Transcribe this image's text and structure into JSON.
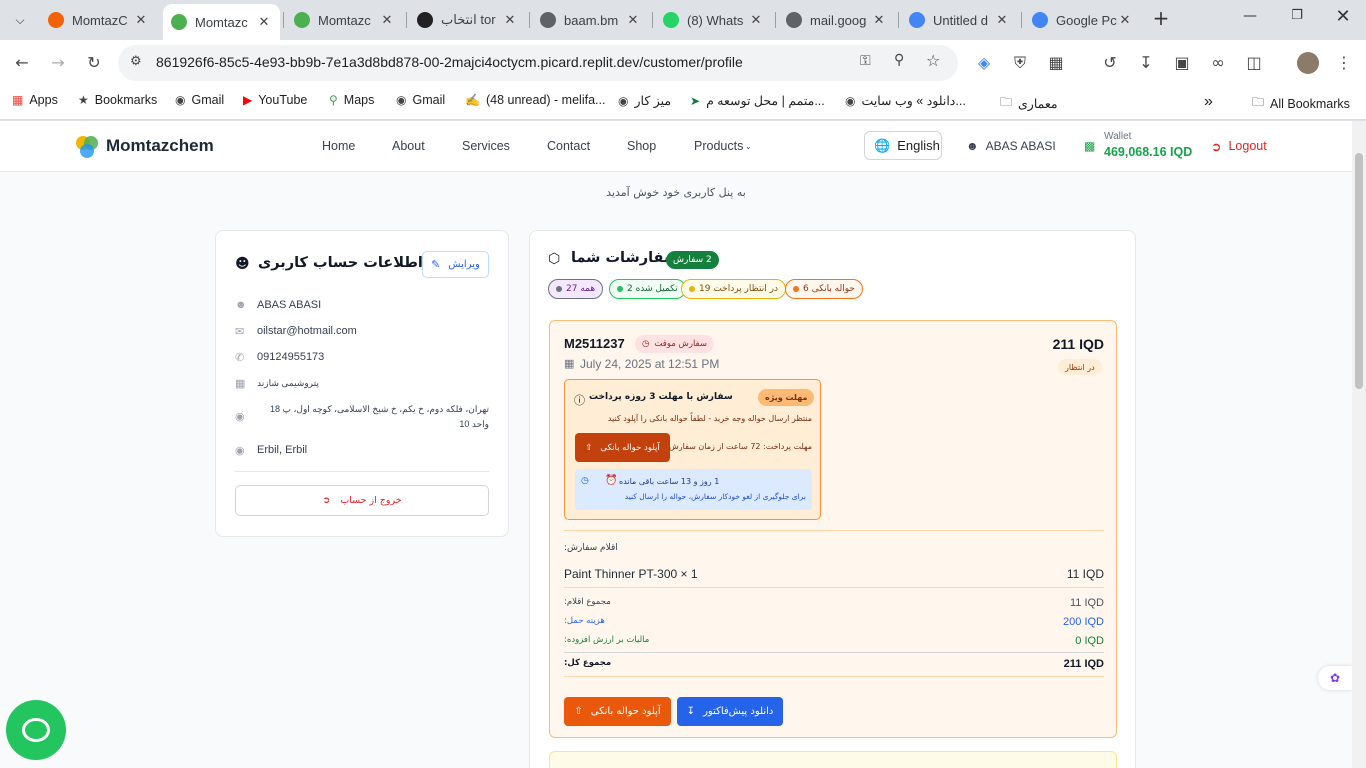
{
  "browser": {
    "tabs": [
      {
        "title": "MomtazC",
        "favicon": "replit-icon",
        "color": "#f26207"
      },
      {
        "title": "Momtazc",
        "favicon": "momtaz-logo-icon",
        "color": "#4caf50"
      },
      {
        "title": "Momtazc",
        "favicon": "momtaz-logo-icon",
        "color": "#4caf50"
      },
      {
        "title": "انتخاب tor",
        "favicon": "chatgpt-icon",
        "color": "#222222"
      },
      {
        "title": "baam.bm",
        "favicon": "globe-icon",
        "color": "#5f6368"
      },
      {
        "title": "(8) Whats",
        "favicon": "whatsapp-icon",
        "color": "#25d366"
      },
      {
        "title": "mail.goog",
        "favicon": "globe-icon",
        "color": "#5f6368"
      },
      {
        "title": "Untitled d",
        "favicon": "globe-icon",
        "color": "#4285f4"
      },
      {
        "title": "Google Pc",
        "favicon": "google-icon",
        "color": "#4285f4"
      }
    ],
    "url": "861926f6-85c5-4e93-bb9b-7e1a3d8bd878-00-2majci4octycm.picard.replit.dev/customer/profile",
    "bookmarks": [
      {
        "label": "Apps",
        "icon": "apps-grid-icon"
      },
      {
        "label": "Bookmarks",
        "icon": "star-icon"
      },
      {
        "label": "Gmail",
        "icon": "globe-icon"
      },
      {
        "label": "YouTube",
        "icon": "youtube-icon"
      },
      {
        "label": "Maps",
        "icon": "maps-icon"
      },
      {
        "label": "Gmail",
        "icon": "globe-icon"
      },
      {
        "label": "(48 unread) - melifa...",
        "icon": "yahoo-icon"
      },
      {
        "label": "میز کار",
        "icon": "globe-icon"
      },
      {
        "label": "متمم | محل توسعه م...",
        "icon": "motamem-icon"
      },
      {
        "label": "دانلود » وب سایت...",
        "icon": "globe-icon"
      },
      {
        "label": "معماری",
        "icon": "folder-icon"
      }
    ],
    "all_bookmarks": "All Bookmarks"
  },
  "site": {
    "brand": "Momtazchem",
    "nav": [
      "Home",
      "About",
      "Services",
      "Contact",
      "Shop",
      "Products"
    ],
    "language": "English",
    "user": "ABAS ABASI",
    "wallet_label": "Wallet",
    "wallet_value": "469,068.16 IQD",
    "logout": "Logout",
    "welcome": "به پنل کاربری خود خوش آمدید"
  },
  "profile": {
    "title": "اطلاعات حساب کاربری",
    "edit": "ویرایش",
    "name": "ABAS ABASI",
    "email": "oilstar@hotmail.com",
    "phone": "09124955173",
    "company": "پتروشیمی شازند",
    "address": "تهران، فلکه دوم، خ یکم، خ شیخ الاسلامی، کوچه اول، پ 18 واحد 10",
    "city": "Erbil, Erbil",
    "logout_account": "خروج از حساب"
  },
  "orders": {
    "title": "سفارشات شما",
    "count_badge": "2 سفارش",
    "filters": [
      {
        "label": "همه 27",
        "color": "#6b21a8",
        "bg": "#f3e8ff",
        "dot": "#6b7280"
      },
      {
        "label": "تکمیل شده 2",
        "color": "#166534",
        "bg": "#f0fdf4",
        "dot": "#22c55e"
      },
      {
        "label": "در انتظار پرداخت 19",
        "color": "#854d0e",
        "bg": "#fefce8",
        "dot": "#eab308"
      },
      {
        "label": "حواله بانکی 6",
        "color": "#9a3412",
        "bg": "#fff7ed",
        "dot": "#f97316"
      }
    ],
    "order": {
      "number": "M2511237",
      "temp_badge": "سفارش موقت",
      "date": "July 24, 2025 at 12:51 PM",
      "amount": "211 IQD",
      "status": "در انتظار",
      "notice_title": "سفارش با مهلت 3 روزه پرداخت",
      "notice_badge": "مهلت ویژه",
      "notice_text": "منتظر ارسال حواله وجه خرید - لطفاً حواله بانکی را آپلود کنید",
      "deadline_text": "مهلت پرداخت: 72 ساعت از زمان سفارش",
      "upload_btn": "آپلود حواله بانکی",
      "remaining": "1 روز و 13 ساعت باقی مانده",
      "remaining_note": "برای جلوگیری از لغو خودکار سفارش، حواله را ارسال کنید",
      "items_label": "اقلام سفارش:",
      "item_name": "Paint Thinner PT-300 × 1",
      "item_price": "11 IQD",
      "subtotal_label": "مجموع اقلام:",
      "subtotal": "11 IQD",
      "shipping_label": "هزینه حمل:",
      "shipping": "200 IQD",
      "vat_label": "مالیات بر ارزش افزوده:",
      "vat": "0 IQD",
      "total_label": "مجموع کل:",
      "total": "211 IQD",
      "download_btn": "دانلود پیش‌فاکتور",
      "upload_btn2": "آپلود حواله بانکی"
    }
  },
  "colors": {
    "brand_green": "#16a34a",
    "danger": "#dc2626",
    "orange_btn": "#ea580c",
    "blue_btn": "#2563eb"
  }
}
